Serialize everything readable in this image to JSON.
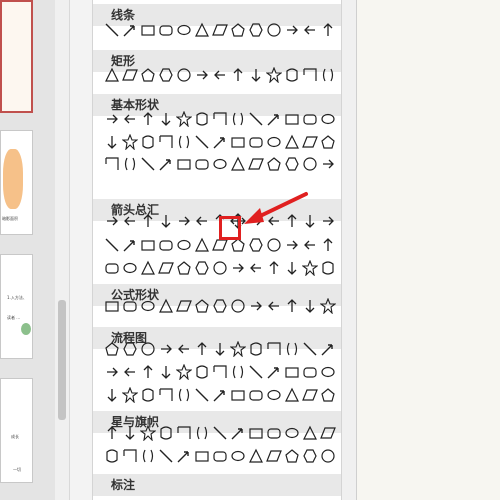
{
  "gallery": {
    "categories": [
      {
        "title": "线条",
        "rows": 1
      },
      {
        "title": "矩形",
        "rows": 1
      },
      {
        "title": "基本形状",
        "rows": 3
      },
      {
        "title": "箭头总汇",
        "rows": 3
      },
      {
        "title": "公式形状",
        "rows": 1
      },
      {
        "title": "流程图",
        "rows": 3
      },
      {
        "title": "星与旗帜",
        "rows": 2
      },
      {
        "title": "标注",
        "rows": 1
      }
    ],
    "selected_shape": "quad-arrow-icon"
  },
  "thumbnails": {
    "texts": [
      "暗影面积",
      "1.入方法、",
      "读者 …",
      "成长",
      "一切"
    ]
  },
  "colors": {
    "highlight": "#e02020",
    "selected_slide_border": "#c0504d",
    "header_bg": "#e8e8e8"
  }
}
